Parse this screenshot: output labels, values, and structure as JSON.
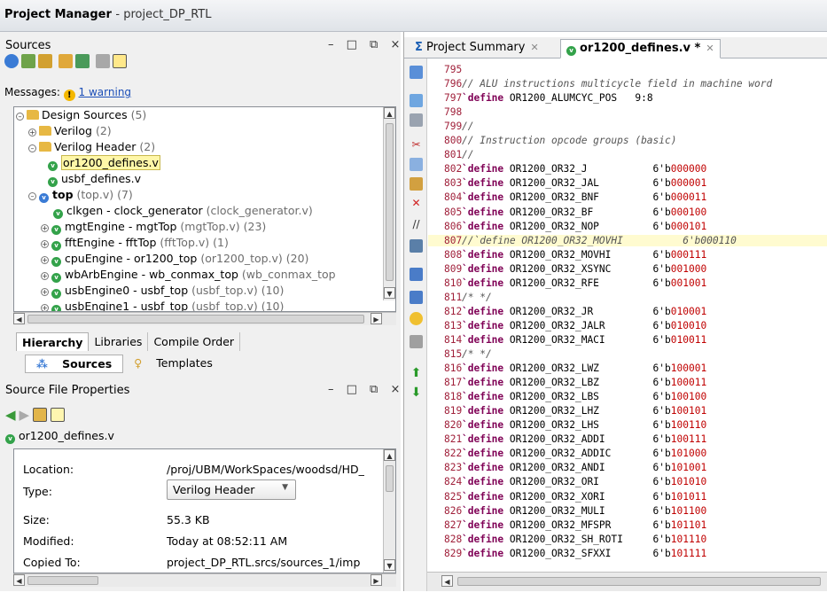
{
  "window": {
    "title": "Project Manager",
    "project": "project_DP_RTL"
  },
  "sources": {
    "title": "Sources",
    "controls": "– □ ⧉ ×",
    "messages_label": "Messages:",
    "warning_link": "1 warning",
    "tree": [
      {
        "label": "Design Sources",
        "count": "(5)"
      },
      {
        "label": "Verilog",
        "count": "(2)"
      },
      {
        "label": "Verilog Header",
        "count": "(2)"
      },
      {
        "label": "or1200_defines.v",
        "count": ""
      },
      {
        "label": "usbf_defines.v",
        "count": ""
      },
      {
        "label": "top",
        "count": "(top.v) (7)"
      },
      {
        "label": "clkgen - clock_generator",
        "count": "(clock_generator.v)"
      },
      {
        "label": "mgtEngine - mgtTop",
        "count": "(mgtTop.v) (23)"
      },
      {
        "label": "fftEngine - fftTop",
        "count": "(fftTop.v) (1)"
      },
      {
        "label": "cpuEngine - or1200_top",
        "count": "(or1200_top.v) (20)"
      },
      {
        "label": "wbArbEngine - wb_conmax_top",
        "count": "(wb_conmax_top"
      },
      {
        "label": "usbEngine0 - usbf_top",
        "count": "(usbf_top.v) (10)"
      },
      {
        "label": "usbEngine1 - usbf_top",
        "count": "(usbf_top.v) (10)"
      }
    ],
    "tabs": [
      "Hierarchy",
      "Libraries",
      "Compile Order"
    ],
    "subtabs": [
      "Sources",
      "Templates"
    ]
  },
  "file_props": {
    "title": "Source File Properties",
    "controls": "– □ ⧉ ×",
    "file": "or1200_defines.v",
    "rows": [
      {
        "label": "Location:",
        "value": "/proj/UBM/WorkSpaces/woodsd/HD_"
      },
      {
        "label": "Type:",
        "value": "Verilog Header"
      },
      {
        "label": "Size:",
        "value": "55.3 KB"
      },
      {
        "label": "Modified:",
        "value": "Today at 08:52:11 AM"
      },
      {
        "label": "Copied To:",
        "value": "project_DP_RTL.srcs/sources_1/imp"
      }
    ]
  },
  "editor": {
    "tabs": [
      {
        "label": "Project Summary"
      },
      {
        "label": "or1200_defines.v *"
      }
    ],
    "lines": [
      {
        "n": "795",
        "kind": "blank",
        "text": ""
      },
      {
        "n": "796",
        "kind": "comment",
        "text": "// ALU instructions multicycle field in machine word"
      },
      {
        "n": "797",
        "kind": "define",
        "text": "OR1200_ALUMCYC_POS",
        "val": "9:8",
        "bin": ""
      },
      {
        "n": "798",
        "kind": "blank",
        "text": ""
      },
      {
        "n": "799",
        "kind": "comment",
        "text": "//"
      },
      {
        "n": "800",
        "kind": "comment",
        "text": "// Instruction opcode groups (basic)"
      },
      {
        "n": "801",
        "kind": "comment",
        "text": "//"
      },
      {
        "n": "802",
        "kind": "define",
        "text": "OR1200_OR32_J",
        "val": "6'b",
        "bin": "000000"
      },
      {
        "n": "803",
        "kind": "define",
        "text": "OR1200_OR32_JAL",
        "val": "6'b",
        "bin": "000001"
      },
      {
        "n": "804",
        "kind": "define",
        "text": "OR1200_OR32_BNF",
        "val": "6'b",
        "bin": "000011"
      },
      {
        "n": "805",
        "kind": "define",
        "text": "OR1200_OR32_BF",
        "val": "6'b",
        "bin": "000100"
      },
      {
        "n": "806",
        "kind": "define",
        "text": "OR1200_OR32_NOP",
        "val": "6'b",
        "bin": "000101"
      },
      {
        "n": "807",
        "kind": "comment-hl",
        "text": "//`define OR1200_OR32_MOVHI          6'b000110"
      },
      {
        "n": "808",
        "kind": "define",
        "text": "OR1200_OR32_MOVHI",
        "val": "6'b",
        "bin": "000111"
      },
      {
        "n": "809",
        "kind": "define",
        "text": "OR1200_OR32_XSYNC",
        "val": "6'b",
        "bin": "001000"
      },
      {
        "n": "810",
        "kind": "define",
        "text": "OR1200_OR32_RFE",
        "val": "6'b",
        "bin": "001001"
      },
      {
        "n": "811",
        "kind": "comment",
        "text": "/* */"
      },
      {
        "n": "812",
        "kind": "define",
        "text": "OR1200_OR32_JR",
        "val": "6'b",
        "bin": "010001"
      },
      {
        "n": "813",
        "kind": "define",
        "text": "OR1200_OR32_JALR",
        "val": "6'b",
        "bin": "010010"
      },
      {
        "n": "814",
        "kind": "define",
        "text": "OR1200_OR32_MACI",
        "val": "6'b",
        "bin": "010011"
      },
      {
        "n": "815",
        "kind": "comment",
        "text": "/* */"
      },
      {
        "n": "816",
        "kind": "define",
        "text": "OR1200_OR32_LWZ",
        "val": "6'b",
        "bin": "100001"
      },
      {
        "n": "817",
        "kind": "define",
        "text": "OR1200_OR32_LBZ",
        "val": "6'b",
        "bin": "100011"
      },
      {
        "n": "818",
        "kind": "define",
        "text": "OR1200_OR32_LBS",
        "val": "6'b",
        "bin": "100100"
      },
      {
        "n": "819",
        "kind": "define",
        "text": "OR1200_OR32_LHZ",
        "val": "6'b",
        "bin": "100101"
      },
      {
        "n": "820",
        "kind": "define",
        "text": "OR1200_OR32_LHS",
        "val": "6'b",
        "bin": "100110"
      },
      {
        "n": "821",
        "kind": "define",
        "text": "OR1200_OR32_ADDI",
        "val": "6'b",
        "bin": "100111"
      },
      {
        "n": "822",
        "kind": "define",
        "text": "OR1200_OR32_ADDIC",
        "val": "6'b",
        "bin": "101000"
      },
      {
        "n": "823",
        "kind": "define",
        "text": "OR1200_OR32_ANDI",
        "val": "6'b",
        "bin": "101001"
      },
      {
        "n": "824",
        "kind": "define",
        "text": "OR1200_OR32_ORI",
        "val": "6'b",
        "bin": "101010"
      },
      {
        "n": "825",
        "kind": "define",
        "text": "OR1200_OR32_XORI",
        "val": "6'b",
        "bin": "101011"
      },
      {
        "n": "826",
        "kind": "define",
        "text": "OR1200_OR32_MULI",
        "val": "6'b",
        "bin": "101100"
      },
      {
        "n": "827",
        "kind": "define",
        "text": "OR1200_OR32_MFSPR",
        "val": "6'b",
        "bin": "101101"
      },
      {
        "n": "828",
        "kind": "define",
        "text": "OR1200_OR32_SH_ROTI",
        "val": "6'b",
        "bin": "101110"
      },
      {
        "n": "829",
        "kind": "define",
        "text": "OR1200_OR32_SFXXI",
        "val": "6'b",
        "bin": "101111"
      }
    ]
  }
}
